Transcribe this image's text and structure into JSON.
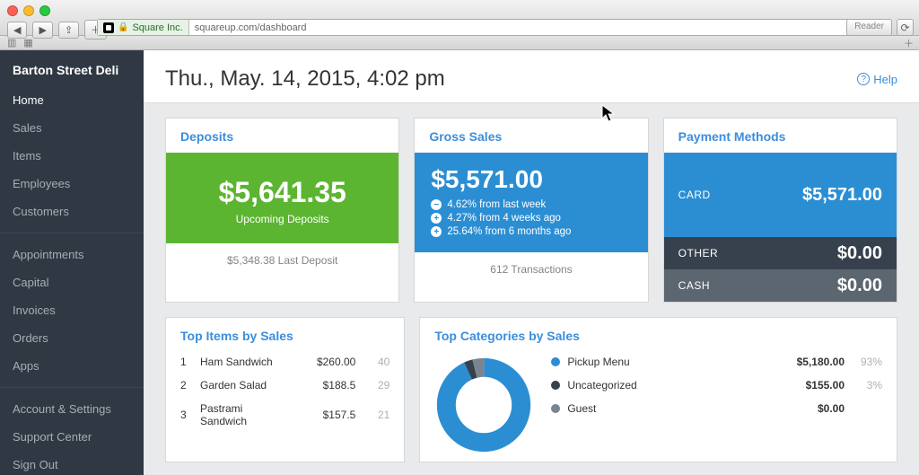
{
  "browser": {
    "site_badge": "Square Inc.",
    "url": "squareup.com/dashboard",
    "reader_label": "Reader"
  },
  "sidebar": {
    "business_name": "Barton Street Deli",
    "group1": [
      {
        "label": "Home",
        "active": true
      },
      {
        "label": "Sales",
        "active": false
      },
      {
        "label": "Items",
        "active": false
      },
      {
        "label": "Employees",
        "active": false
      },
      {
        "label": "Customers",
        "active": false
      }
    ],
    "group2": [
      {
        "label": "Appointments"
      },
      {
        "label": "Capital"
      },
      {
        "label": "Invoices"
      },
      {
        "label": "Orders"
      },
      {
        "label": "Apps"
      }
    ],
    "group3": [
      {
        "label": "Account & Settings"
      },
      {
        "label": "Support Center"
      },
      {
        "label": "Sign Out"
      }
    ]
  },
  "header": {
    "title": "Thu., May. 14, 2015, 4:02 pm",
    "help_label": "Help"
  },
  "deposits": {
    "card_title": "Deposits",
    "amount": "$5,641.35",
    "subtitle": "Upcoming Deposits",
    "footer": "$5,348.38 Last Deposit"
  },
  "gross": {
    "card_title": "Gross Sales",
    "amount": "$5,571.00",
    "stats": [
      {
        "dir": "down",
        "text": "4.62% from last week"
      },
      {
        "dir": "up",
        "text": "4.27% from 4 weeks ago"
      },
      {
        "dir": "up",
        "text": "25.64% from 6 months ago"
      }
    ],
    "footer": "612 Transactions"
  },
  "payment_methods": {
    "card_title": "Payment Methods",
    "rows": [
      {
        "label": "CARD",
        "value": "$5,571.00"
      },
      {
        "label": "OTHER",
        "value": "$0.00"
      },
      {
        "label": "CASH",
        "value": "$0.00"
      }
    ]
  },
  "top_items": {
    "title": "Top Items by Sales",
    "rows": [
      {
        "rank": "1",
        "name": "Ham Sandwich",
        "amount": "$260.00",
        "count": "40"
      },
      {
        "rank": "2",
        "name": "Garden Salad",
        "amount": "$188.5",
        "count": "29"
      },
      {
        "rank": "3",
        "name": "Pastrami Sandwich",
        "amount": "$157.5",
        "count": "21"
      }
    ]
  },
  "top_categories": {
    "title": "Top Categories by Sales",
    "rows": [
      {
        "color": "#2b8ed3",
        "name": "Pickup Menu",
        "amount": "$5,180.00",
        "pct": "93%"
      },
      {
        "color": "#36414d",
        "name": "Uncategorized",
        "amount": "$155.00",
        "pct": "3%"
      },
      {
        "color": "#7a8591",
        "name": "Guest",
        "amount": "$0.00",
        "pct": ""
      }
    ]
  },
  "chart_data": {
    "type": "pie",
    "title": "Top Categories by Sales",
    "series": [
      {
        "name": "Pickup Menu",
        "value": 5180.0,
        "pct": 93,
        "color": "#2b8ed3"
      },
      {
        "name": "Uncategorized",
        "value": 155.0,
        "pct": 3,
        "color": "#36414d"
      },
      {
        "name": "Guest",
        "value": 0.0,
        "pct": 0,
        "color": "#7a8591"
      }
    ]
  }
}
